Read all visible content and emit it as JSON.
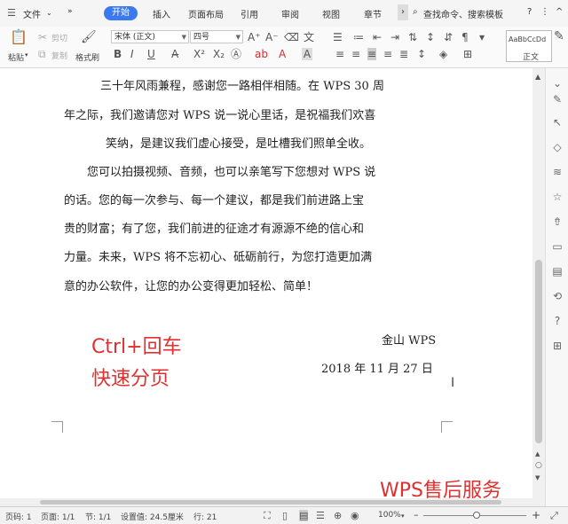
{
  "menu": {
    "file": "文件",
    "tabs": [
      "开始",
      "插入",
      "页面布局",
      "引用",
      "审阅",
      "视图",
      "章节"
    ],
    "search": "查找命令、搜索模板",
    "help": "?",
    "more": "⋮",
    "collapse": "^"
  },
  "ribbon": {
    "paste": "粘贴",
    "cut": "剪切",
    "copy": "复制",
    "format_painter": "格式刷",
    "font_name": "宋体 (正文)",
    "font_size": "四号",
    "style_preview": "AaBbCcDd",
    "style_name": "正文"
  },
  "document": {
    "paragraph1": [
      "三十年风雨兼程，感谢您一路相伴相随。在 WPS 30 周",
      "年之际，我们邀请您对 WPS 说一说心里话，是祝福我们欢喜",
      "笑纳，是建议我们虚心接受，是吐槽我们照单全收。"
    ],
    "paragraph2": [
      "您可以拍摄视频、音频，也可以亲笔写下您想对 WPS 说",
      "的话。您的每一次参与、每一个建议，都是我们前进路上宝",
      "贵的财富；有了您，我们前进的征途才有源源不绝的信心和",
      "力量。未来，WPS 将不忘初心、砥砺前行，为您打造更加满",
      "意的办公软件，让您的办公变得更加轻松、简单！"
    ],
    "signature": "金山  WPS",
    "date": "2018 年 11 月 27 日",
    "overlay_line1": "Ctrl+回车",
    "overlay_line2": "快速分页",
    "watermark": "WPS售后服务"
  },
  "status": {
    "page": "页码: 1",
    "pages": "页面: 1/1",
    "section": "节: 1/1",
    "setting": "设置值: 24.5厘米",
    "row": "行: 21",
    "zoom": "100%",
    "zoom_out": "–",
    "zoom_in": "+"
  }
}
